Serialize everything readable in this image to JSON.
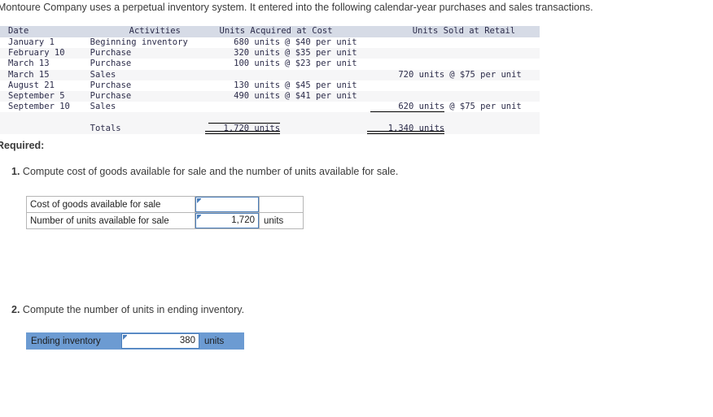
{
  "intro": "Montoure Company uses a perpetual inventory system. It entered into the following calendar-year purchases and sales transactions.",
  "transactions_table": {
    "headers": {
      "date": "Date",
      "activities": "Activities",
      "units_acquired": "Units Acquired at Cost",
      "units_sold": "Units Sold at Retail"
    },
    "rows": [
      {
        "date": "January 1",
        "activity": "Beginning inventory",
        "acq_units": "680 units",
        "acq_price": "@ $40 per unit",
        "sold_units": "",
        "sold_price": ""
      },
      {
        "date": "February 10",
        "activity": "Purchase",
        "acq_units": "320 units",
        "acq_price": "@ $35 per unit",
        "sold_units": "",
        "sold_price": ""
      },
      {
        "date": "March 13",
        "activity": "Purchase",
        "acq_units": "100 units",
        "acq_price": "@ $23 per unit",
        "sold_units": "",
        "sold_price": ""
      },
      {
        "date": "March 15",
        "activity": "Sales",
        "acq_units": "",
        "acq_price": "",
        "sold_units": "720 units",
        "sold_price": "@ $75 per unit"
      },
      {
        "date": "August 21",
        "activity": "Purchase",
        "acq_units": "130 units",
        "acq_price": "@ $45 per unit",
        "sold_units": "",
        "sold_price": ""
      },
      {
        "date": "September 5",
        "activity": "Purchase",
        "acq_units": "490 units",
        "acq_price": "@ $41 per unit",
        "sold_units": "",
        "sold_price": ""
      },
      {
        "date": "September 10",
        "activity": "Sales",
        "acq_units": "",
        "acq_price": "",
        "sold_units": "620 units",
        "sold_price": "@ $75 per unit"
      }
    ],
    "totals": {
      "label": "Totals",
      "acquired": "1,720 units",
      "sold": "1,340 units"
    }
  },
  "required_label": "Required:",
  "question1": {
    "number": "1.",
    "text": "Compute cost of goods available for sale and the number of units available for sale.",
    "rows": [
      {
        "label": "Cost of goods available for sale",
        "value": "",
        "unit": ""
      },
      {
        "label": "Number of units available for sale",
        "value": "1,720",
        "unit": "units"
      }
    ]
  },
  "question2": {
    "number": "2.",
    "text": "Compute the number of units in ending inventory.",
    "row": {
      "label": "Ending inventory",
      "value": "380",
      "unit": "units"
    }
  },
  "colors": {
    "table_header_bg": "#d6dbe6",
    "row_alt_bg": "#f6f6f7",
    "input_border": "#4a7ebb",
    "highlight_row_bg": "#6c9bd2",
    "text": "#3a3a3a"
  }
}
